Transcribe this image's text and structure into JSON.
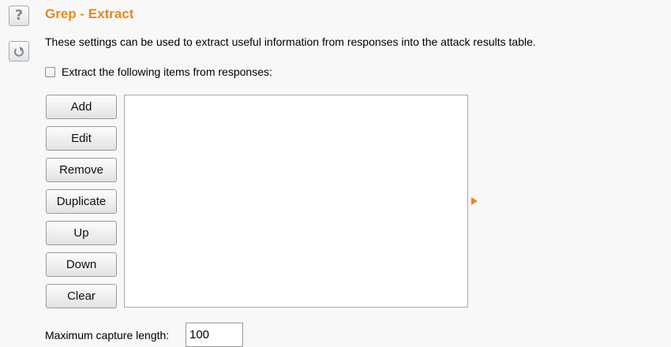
{
  "icons": {
    "help": "help-icon",
    "reset": "reset-icon"
  },
  "help_glyph": "?",
  "colors": {
    "accent": "#e8891b",
    "background": "#f8f8f8",
    "list_background": "#ffffff"
  },
  "section": {
    "title": "Grep - Extract",
    "description": "These settings can be used to extract useful information from responses into the attack results table."
  },
  "extract_option": {
    "label": "Extract the following items from responses:",
    "checked": false
  },
  "buttons": {
    "add": "Add",
    "edit": "Edit",
    "remove": "Remove",
    "duplicate": "Duplicate",
    "up": "Up",
    "down": "Down",
    "clear": "Clear"
  },
  "items_list": [],
  "max_capture": {
    "label": "Maximum capture length:",
    "value": "100"
  }
}
